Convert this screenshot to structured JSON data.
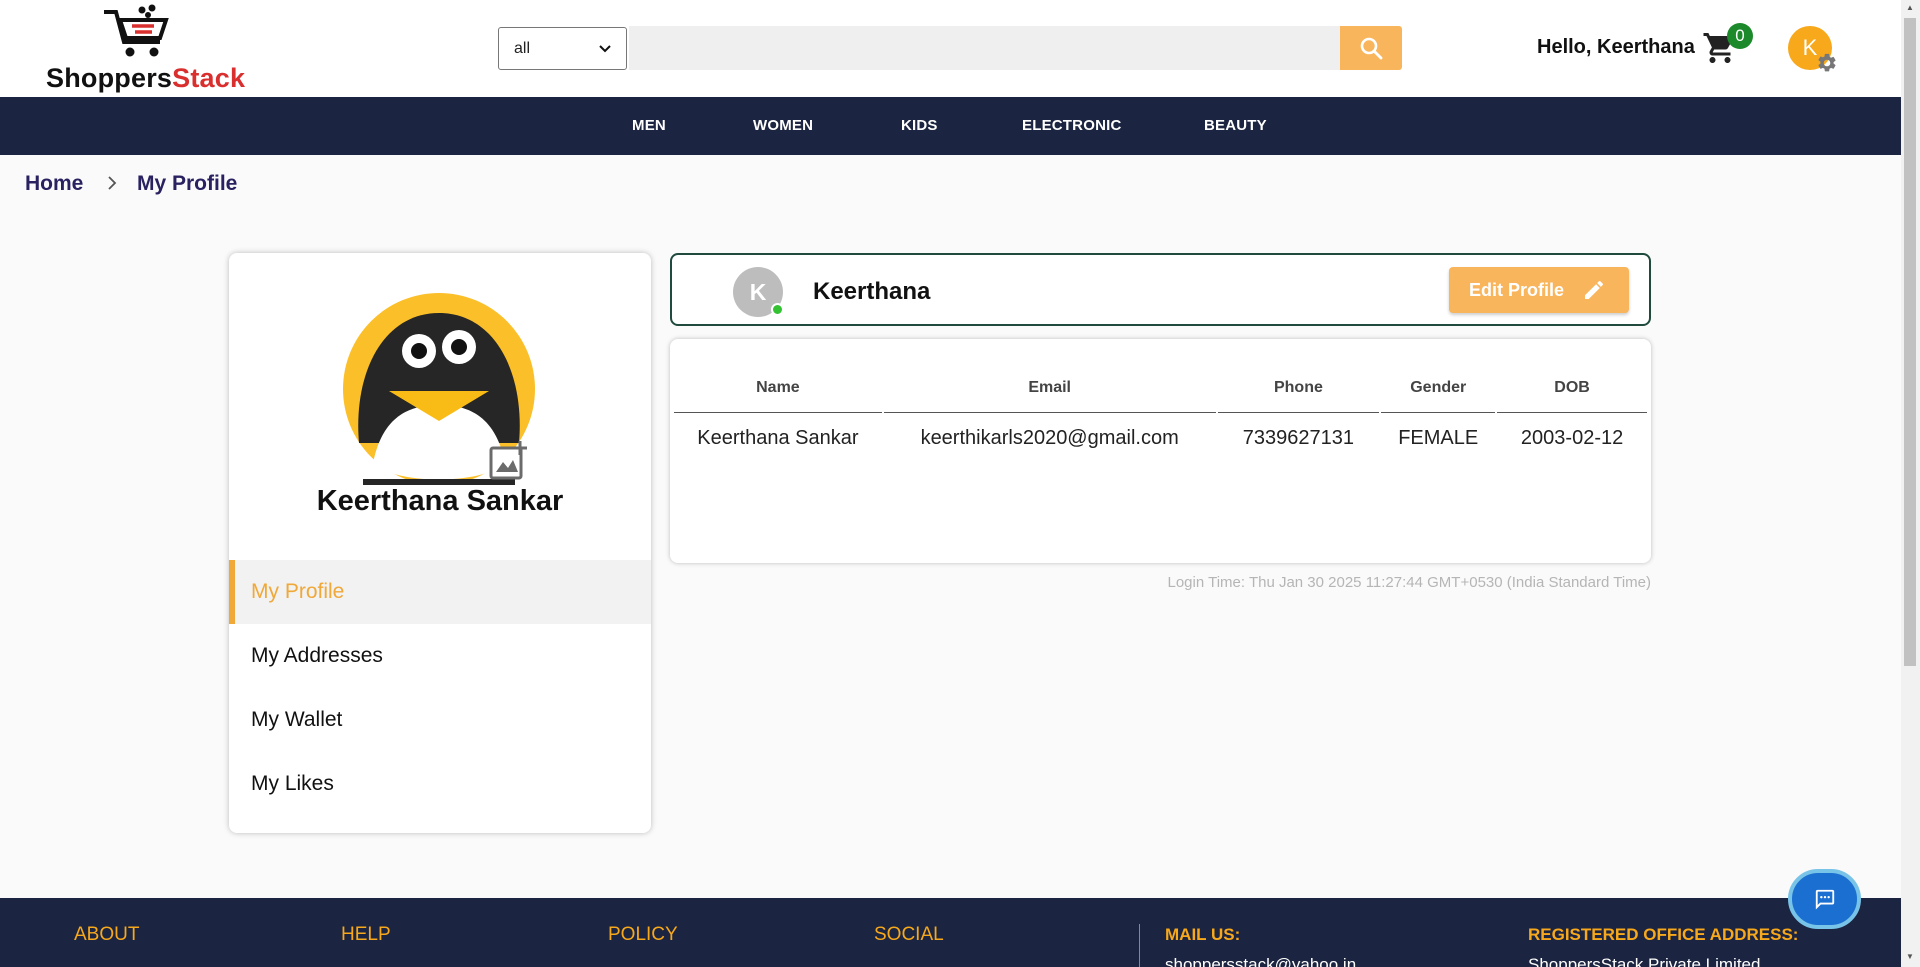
{
  "brand": {
    "name_part1": "Shoppers",
    "name_part2": "Stack",
    "accent": "#d92f2f"
  },
  "search": {
    "category_selected": "all",
    "placeholder": "",
    "button_icon": "search-icon"
  },
  "header": {
    "greeting": "Hello, Keerthana",
    "cart_count": "0",
    "avatar_letter": "K"
  },
  "nav": {
    "items": [
      "MEN",
      "WOMEN",
      "KIDS",
      "ELECTRONIC",
      "BEAUTY"
    ]
  },
  "breadcrumb": {
    "home": "Home",
    "current": "My Profile"
  },
  "sidebar": {
    "profile_name": "Keerthana Sankar",
    "items": [
      {
        "label": "My Profile",
        "active": true
      },
      {
        "label": "My Addresses",
        "active": false
      },
      {
        "label": "My Wallet",
        "active": false
      },
      {
        "label": "My Likes",
        "active": false
      }
    ]
  },
  "profile_header": {
    "avatar_letter": "K",
    "name": "Keerthana",
    "edit_label": "Edit Profile"
  },
  "details": {
    "columns": [
      "Name",
      "Email",
      "Phone",
      "Gender",
      "DOB"
    ],
    "row": [
      "Keerthana Sankar",
      "keerthikarls2020@gmail.com",
      "7339627131",
      "FEMALE",
      "2003-02-12"
    ]
  },
  "login_time": "Login Time: Thu Jan 30 2025 11:27:44 GMT+0530 (India Standard Time)",
  "footer": {
    "about": "ABOUT",
    "help": "HELP",
    "policy": "POLICY",
    "social": "SOCIAL",
    "mail_heading": "MAIL US:",
    "mail_value": "shoppersstack@yahoo.in",
    "office_heading": "REGISTERED OFFICE ADDRESS:",
    "office_value": "ShoppersStack Private Limited"
  },
  "colors": {
    "navy": "#1b2440",
    "orange": "#f8b55c",
    "gold": "#f7a81b"
  }
}
